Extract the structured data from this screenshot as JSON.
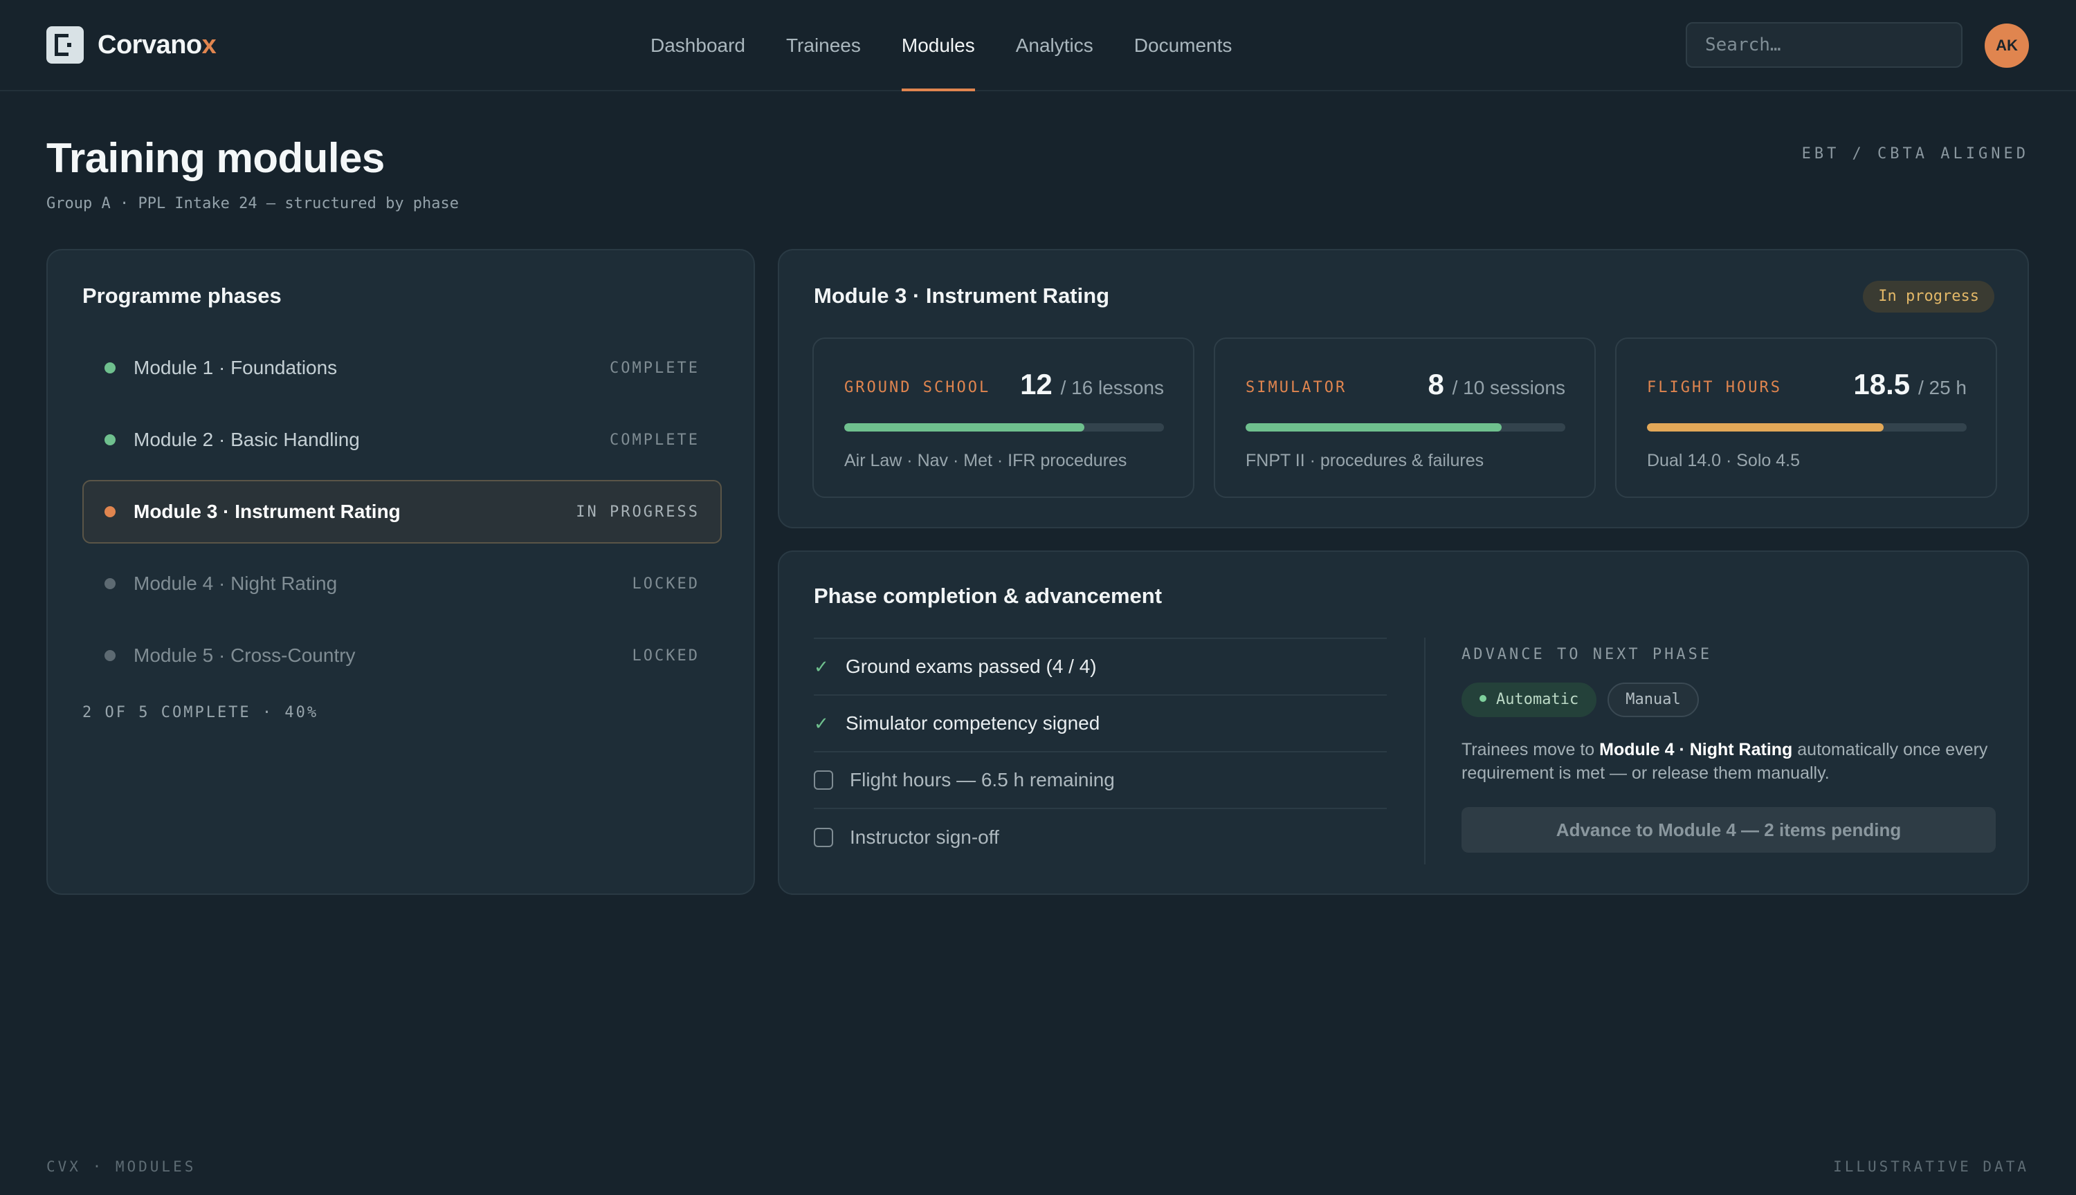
{
  "brand": {
    "name_main": "Corvano",
    "name_accent": "x",
    "accent_color": "#e0854f"
  },
  "nav": {
    "items": [
      {
        "label": "Dashboard"
      },
      {
        "label": "Trainees"
      },
      {
        "label": "Modules",
        "active": true
      },
      {
        "label": "Analytics"
      },
      {
        "label": "Documents"
      }
    ]
  },
  "search": {
    "placeholder": "Search…",
    "value": ""
  },
  "user": {
    "initials": "AK"
  },
  "page": {
    "title": "Training modules",
    "subtitle": "Group A · PPL Intake 24 — structured by phase",
    "tag": "EBT / CBTA ALIGNED"
  },
  "phases": {
    "title": "Programme phases",
    "items": [
      {
        "label": "Module 1 · Foundations",
        "status": "COMPLETE",
        "state": "complete",
        "dot_color": "#6fc08e"
      },
      {
        "label": "Module 2 · Basic Handling",
        "status": "COMPLETE",
        "state": "complete",
        "dot_color": "#6fc08e"
      },
      {
        "label": "Module 3 · Instrument Rating",
        "status": "IN PROGRESS",
        "state": "current",
        "dot_color": "#e0854f"
      },
      {
        "label": "Module 4 · Night Rating",
        "status": "LOCKED",
        "state": "locked",
        "dot_color": "#5d6a72"
      },
      {
        "label": "Module 5 · Cross-Country",
        "status": "LOCKED",
        "state": "locked",
        "dot_color": "#5d6a72"
      }
    ],
    "summary": "2 OF 5 COMPLETE · 40%"
  },
  "module": {
    "title": "Module 3 · Instrument Rating",
    "status": "In progress",
    "metrics": [
      {
        "label": "GROUND SCHOOL",
        "value": "12",
        "suffix": "/ 16 lessons",
        "progress": 0.75,
        "bar_color": "#6fc08e",
        "note": "Air Law · Nav · Met · IFR procedures"
      },
      {
        "label": "SIMULATOR",
        "value": "8",
        "suffix": "/ 10 sessions",
        "progress": 0.8,
        "bar_color": "#6fc08e",
        "note": "FNPT II · procedures & failures"
      },
      {
        "label": "FLIGHT HOURS",
        "value": "18.5",
        "suffix": "/ 25 h",
        "progress": 0.74,
        "bar_color": "#e3a858",
        "note": "Dual 14.0 · Solo 4.5"
      }
    ]
  },
  "completion": {
    "title": "Phase completion & advancement",
    "requirements": [
      {
        "text": "Ground exams passed (4 / 4)",
        "done": true
      },
      {
        "text": "Simulator competency signed",
        "done": true
      },
      {
        "text": "Flight hours — 6.5 h remaining",
        "done": false
      },
      {
        "text": "Instructor sign-off",
        "done": false
      }
    ],
    "advance": {
      "label": "ADVANCE TO NEXT PHASE",
      "mode_automatic": "Automatic",
      "mode_manual": "Manual",
      "desc_before": "Trainees move to ",
      "desc_bold": "Module 4 · Night Rating",
      "desc_after": " automatically once every requirement is met — or release them manually.",
      "button": "Advance to Module 4 — 2 items pending"
    }
  },
  "footer": {
    "left": "CVX · MODULES",
    "right": "ILLUSTRATIVE DATA"
  }
}
